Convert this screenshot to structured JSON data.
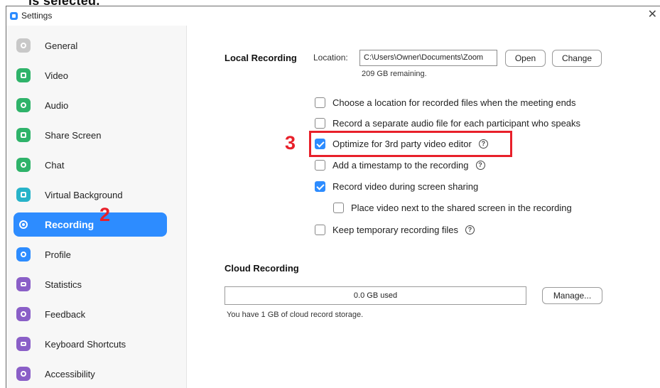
{
  "caption_top": "is selected.",
  "window": {
    "title": "Settings",
    "close_glyph": "✕"
  },
  "sidebar": {
    "items": [
      {
        "label": "General",
        "icon": "gear-icon",
        "color": "#c8c8c8"
      },
      {
        "label": "Video",
        "icon": "video-camera-icon",
        "color": "#2fb36a"
      },
      {
        "label": "Audio",
        "icon": "headphones-icon",
        "color": "#2fb36a"
      },
      {
        "label": "Share Screen",
        "icon": "share-screen-icon",
        "color": "#2fb36a"
      },
      {
        "label": "Chat",
        "icon": "chat-bubble-icon",
        "color": "#2fb36a"
      },
      {
        "label": "Virtual Background",
        "icon": "person-background-icon",
        "color": "#27b3c9"
      },
      {
        "label": "Recording",
        "icon": "record-icon",
        "color": "#2d8cff",
        "active": true
      },
      {
        "label": "Profile",
        "icon": "profile-icon",
        "color": "#2d8cff"
      },
      {
        "label": "Statistics",
        "icon": "statistics-icon",
        "color": "#8a5fc7"
      },
      {
        "label": "Feedback",
        "icon": "feedback-smile-icon",
        "color": "#8a5fc7"
      },
      {
        "label": "Keyboard Shortcuts",
        "icon": "keyboard-icon",
        "color": "#8a5fc7"
      },
      {
        "label": "Accessibility",
        "icon": "accessibility-icon",
        "color": "#8a5fc7"
      }
    ]
  },
  "annotations": {
    "step2": "2",
    "step3": "3"
  },
  "local_recording": {
    "title": "Local Recording",
    "location_label": "Location:",
    "location_value": "C:\\Users\\Owner\\Documents\\Zoom",
    "open_button": "Open",
    "change_button": "Change",
    "remaining": "209 GB remaining.",
    "options": [
      {
        "label": "Choose a location for recorded files when the meeting ends",
        "checked": false,
        "help": false
      },
      {
        "label": "Record a separate audio file for each participant who speaks",
        "checked": false,
        "help": false
      },
      {
        "label": "Optimize for 3rd party video editor",
        "checked": true,
        "help": true
      },
      {
        "label": "Add a timestamp to the recording",
        "checked": false,
        "help": true
      },
      {
        "label": "Record video during screen sharing",
        "checked": true,
        "help": false
      },
      {
        "label": "Place video next to the shared screen in the recording",
        "checked": false,
        "help": false
      },
      {
        "label": "Keep temporary recording files",
        "checked": false,
        "help": true
      }
    ],
    "help_glyph": "?"
  },
  "cloud_recording": {
    "title": "Cloud Recording",
    "used": "0.0 GB used",
    "manage_button": "Manage...",
    "note": "You have 1 GB of cloud record storage."
  },
  "colors": {
    "accent": "#2d8cff",
    "annotation": "#e8202a"
  }
}
